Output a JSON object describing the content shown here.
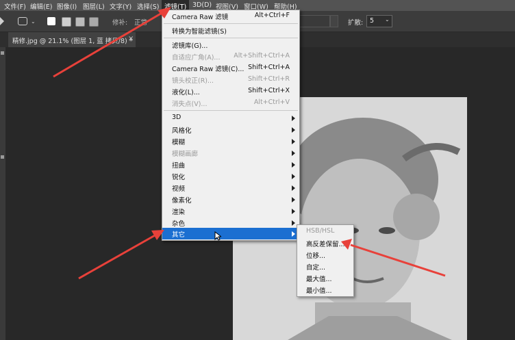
{
  "menubar": {
    "items": [
      "文件(F)",
      "编辑(E)",
      "图像(I)",
      "图层(L)",
      "文字(Y)",
      "选择(S)",
      "滤镜(T)",
      "3D(D)",
      "视图(V)",
      "窗口(W)",
      "帮助(H)"
    ]
  },
  "options_bar": {
    "repair_label": "修补:",
    "repair_value": "正常",
    "diffusion_label": "扩散:",
    "diffusion_value": "5"
  },
  "document_tab": {
    "title": "精修.jpg @ 21.1% (图层 1, 蓝 拷贝/8) *",
    "close": "×"
  },
  "filter_menu": {
    "last_filter": {
      "label": "Camera Raw 滤镜",
      "shortcut": "Alt+Ctrl+F"
    },
    "convert_smart": {
      "label": "转换为智能滤镜(S)"
    },
    "filter_gallery": {
      "label": "滤镜库(G)..."
    },
    "adaptive_wide": {
      "label": "自适应广角(A)...",
      "shortcut": "Alt+Shift+Ctrl+A"
    },
    "camera_raw": {
      "label": "Camera Raw 滤镜(C)...",
      "shortcut": "Shift+Ctrl+A"
    },
    "lens_correction": {
      "label": "镜头校正(R)...",
      "shortcut": "Shift+Ctrl+R"
    },
    "liquify": {
      "label": "液化(L)...",
      "shortcut": "Shift+Ctrl+X"
    },
    "vanishing_point": {
      "label": "消失点(V)...",
      "shortcut": "Alt+Ctrl+V"
    },
    "groups": [
      "3D",
      "风格化",
      "模糊",
      "模糊画廊",
      "扭曲",
      "锐化",
      "视频",
      "像素化",
      "渲染",
      "杂色",
      "其它"
    ]
  },
  "other_submenu": {
    "items": [
      "HSB/HSL",
      "高反差保留...",
      "位移...",
      "自定...",
      "最大值...",
      "最小值..."
    ]
  },
  "colors": {
    "highlight": "#1b6fd1",
    "arrow": "#e8413a"
  }
}
